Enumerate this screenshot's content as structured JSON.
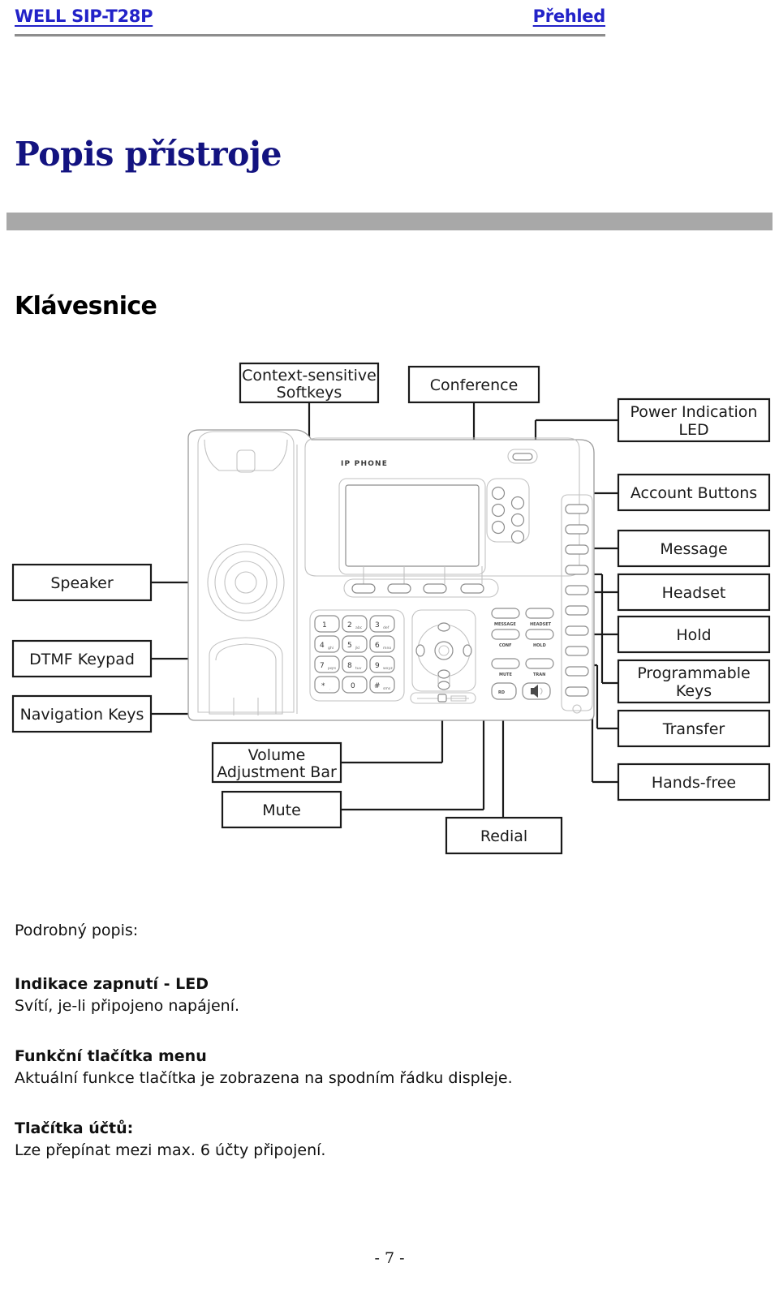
{
  "header": {
    "left_title": "WELL SIP-T28P",
    "right_title": "Přehled",
    "color": "#2222c8"
  },
  "title": {
    "heading": "Popis přístroje",
    "color": "#131380"
  },
  "section": {
    "heading": "Klávesnice"
  },
  "figure": {
    "device_label": "IP PHONE",
    "callouts": {
      "context_softkeys": "Context-sensitive\nSoftkeys",
      "context_softkeys_l1": "Context-sensitive",
      "context_softkeys_l2": "Softkeys",
      "conference": "Conference",
      "power_led_l1": "Power Indication",
      "power_led_l2": "LED",
      "account_buttons": "Account Buttons",
      "message": "Message",
      "headset": "Headset",
      "hold": "Hold",
      "programmable_l1": "Programmable",
      "programmable_l2": "Keys",
      "transfer": "Transfer",
      "hands_free": "Hands-free",
      "speaker": "Speaker",
      "dtmf_keypad": "DTMF Keypad",
      "navigation_keys": "Navigation Keys",
      "volume_l1": "Volume",
      "volume_l2": "Adjustment Bar",
      "mute": "Mute",
      "redial": "Redial"
    },
    "keypad": [
      {
        "digit": "1",
        "letters": ""
      },
      {
        "digit": "2",
        "letters": "abc"
      },
      {
        "digit": "3",
        "letters": "def"
      },
      {
        "digit": "4",
        "letters": "ghi"
      },
      {
        "digit": "5",
        "letters": "jkl"
      },
      {
        "digit": "6",
        "letters": "mno"
      },
      {
        "digit": "7",
        "letters": "pqrs"
      },
      {
        "digit": "8",
        "letters": "tuv"
      },
      {
        "digit": "9",
        "letters": "wxyz"
      },
      {
        "digit": "*",
        "letters": "."
      },
      {
        "digit": "0",
        "letters": ""
      },
      {
        "digit": "#",
        "letters": "sms"
      }
    ],
    "function_keys": [
      "MESSAGE",
      "HEADSET",
      "CONF",
      "HOLD",
      "MUTE",
      "TRAN",
      "RD"
    ],
    "line_color": "#1a1a1a",
    "device_outline_color": "#9a9a9a"
  },
  "body": {
    "intro": "Podrobný popis:",
    "sections": [
      {
        "lead": "Indikace zapnutí - LED",
        "desc": "Svítí, je-li připojeno napájení."
      },
      {
        "lead": "Funkční tlačítka menu",
        "desc": "Aktuální funkce tlačítka je zobrazena na spodním řádku displeje."
      },
      {
        "lead": "Tlačítka účtů:",
        "desc": "Lze přepínat mezi max. 6 účty připojení."
      }
    ]
  },
  "footer": {
    "page_number": "- 7 -"
  }
}
